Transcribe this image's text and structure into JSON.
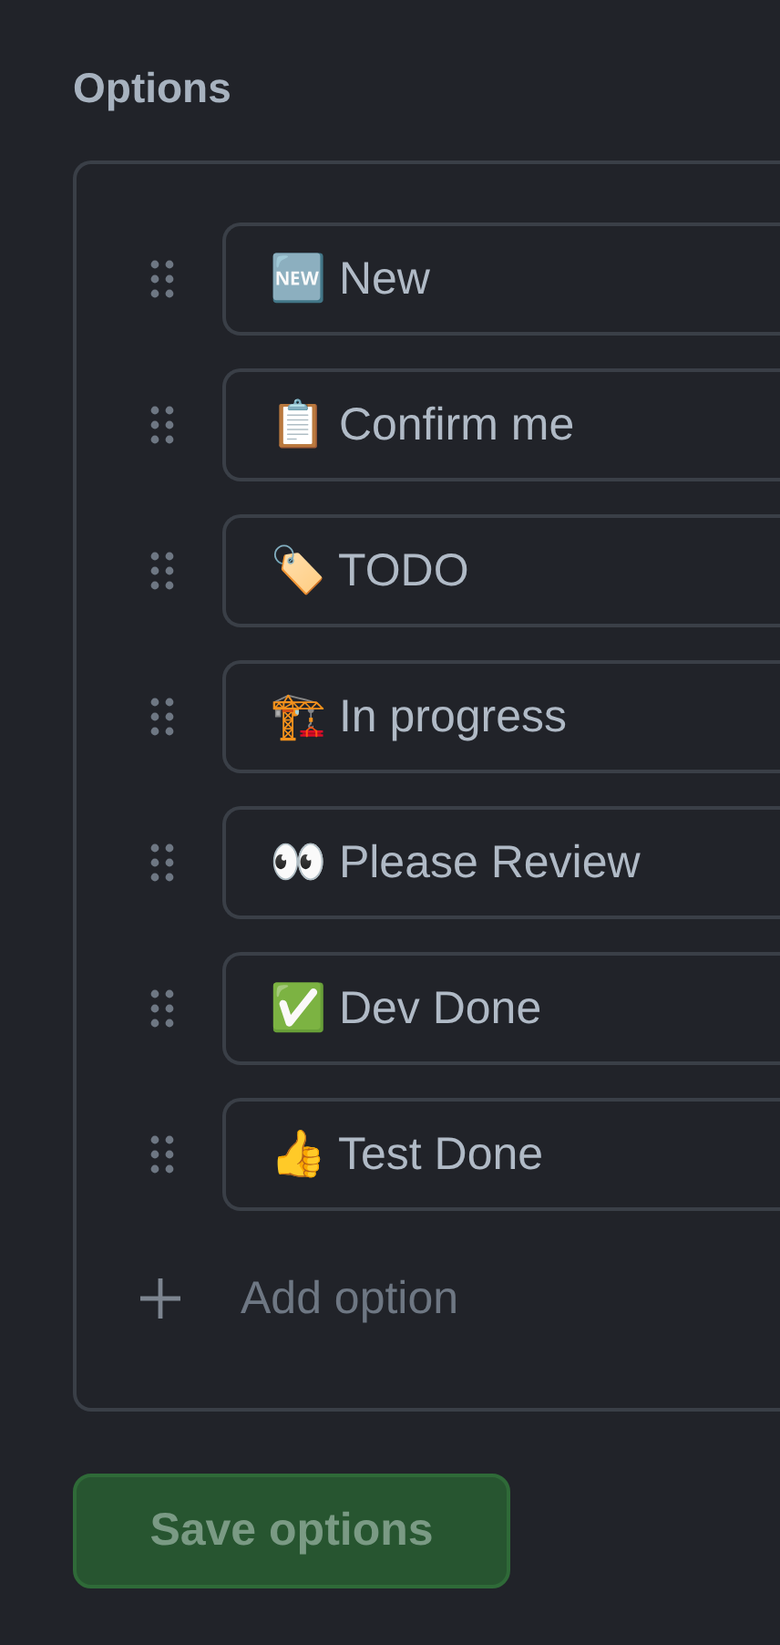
{
  "heading": "Options",
  "options": [
    {
      "value": "🆕 New"
    },
    {
      "value": "📋 Confirm me"
    },
    {
      "value": "🏷️ TODO"
    },
    {
      "value": "🏗️ In progress"
    },
    {
      "value": "👀 Please Review"
    },
    {
      "value": "✅ Dev Done"
    },
    {
      "value": "👍 Test Done"
    }
  ],
  "add_option": {
    "placeholder": "Add option"
  },
  "save_button": {
    "label": "Save options",
    "disabled": true
  }
}
